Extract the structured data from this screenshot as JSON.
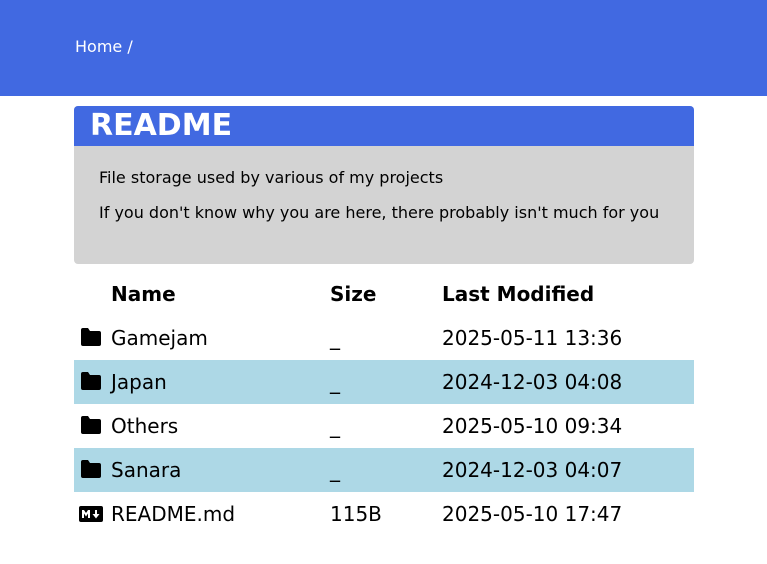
{
  "breadcrumb": {
    "home_label": "Home",
    "separator": "/"
  },
  "readme": {
    "title": "README",
    "lines": [
      "File storage used by various of my projects",
      "If you don't know why you are here, there probably isn't much for you"
    ]
  },
  "files": {
    "columns": {
      "name": "Name",
      "size": "Size",
      "modified": "Last Modified"
    },
    "rows": [
      {
        "icon": "folder-icon",
        "name": "Gamejam",
        "size": "_",
        "modified": "2025-05-11 13:36"
      },
      {
        "icon": "folder-icon",
        "name": "Japan",
        "size": "_",
        "modified": "2024-12-03 04:08"
      },
      {
        "icon": "folder-icon",
        "name": "Others",
        "size": "_",
        "modified": "2025-05-10 09:34"
      },
      {
        "icon": "folder-icon",
        "name": "Sanara",
        "size": "_",
        "modified": "2024-12-03 04:07"
      },
      {
        "icon": "markdown-icon",
        "name": "README.md",
        "size": "115B",
        "modified": "2025-05-10 17:47"
      }
    ]
  },
  "colors": {
    "accent": "#4169e1",
    "readme_background": "#d3d3d3",
    "alt_row": "#add8e6"
  }
}
